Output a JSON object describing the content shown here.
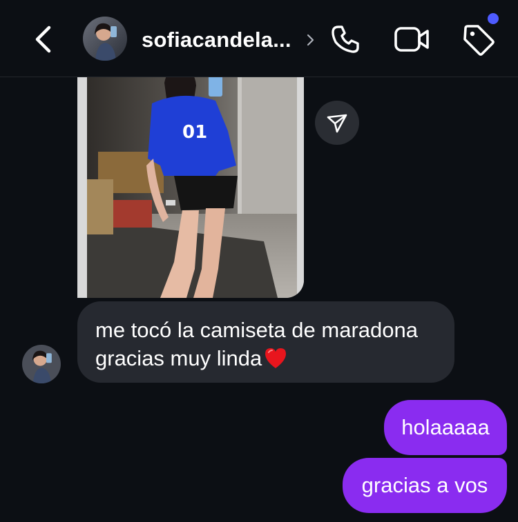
{
  "header": {
    "username": "sofiacandela...",
    "icons": {
      "back": "chevron-left-icon",
      "username_chevron": "chevron-right-icon",
      "call": "phone-icon",
      "video": "video-camera-icon",
      "tag": "tag-icon"
    },
    "notification_dot_color": "#4e5bff"
  },
  "messages": {
    "incoming_image_share_icon": "send-icon",
    "incoming_text_line1": "me tocó la camiseta de maradona",
    "incoming_text_line2": "gracias muy linda",
    "incoming_emoji": "red-heart",
    "outgoing": [
      {
        "text": "holaaaaa"
      },
      {
        "text": "gracias a vos"
      }
    ]
  },
  "colors": {
    "background": "#0c0f14",
    "incoming_bubble": "#262930",
    "outgoing_bubble": "#8a2cf0"
  }
}
